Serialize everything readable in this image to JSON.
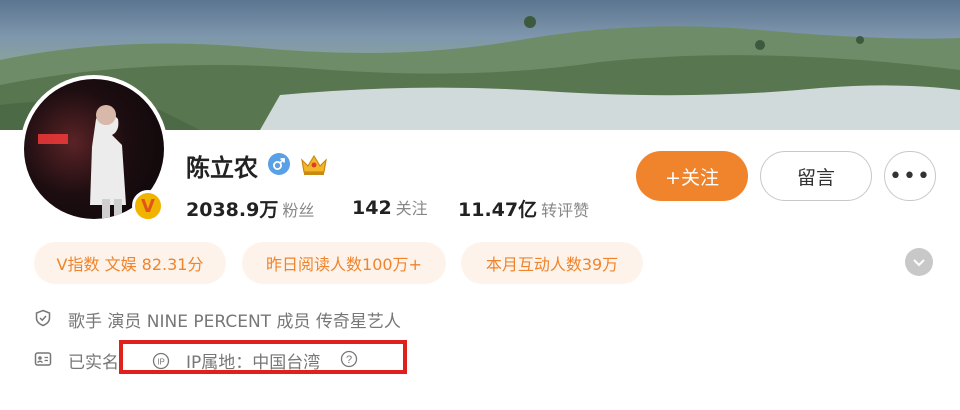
{
  "profile": {
    "name": "陈立农",
    "gender_icon": "male-icon",
    "vip_icon": "crown-icon",
    "verified_badge": "V"
  },
  "stats": [
    {
      "value": "2038.9万",
      "label": "粉丝"
    },
    {
      "value": "142",
      "label": "关注"
    },
    {
      "value": "11.47亿",
      "label": "转评赞"
    }
  ],
  "actions": {
    "follow_label": "+关注",
    "message_label": "留言",
    "more_label": "•••"
  },
  "pills": [
    "V指数 文娱 82.31分",
    "昨日阅读人数100万+",
    "本月互动人数39万"
  ],
  "info": {
    "description": "歌手 演员 NINE PERCENT 成员 传奇星艺人",
    "realname": "已实名",
    "ip": "IP属地：中国台湾"
  },
  "colors": {
    "accent": "#f0842c",
    "pill_bg": "#fdf3ea",
    "highlight_box": "#e0201a"
  }
}
